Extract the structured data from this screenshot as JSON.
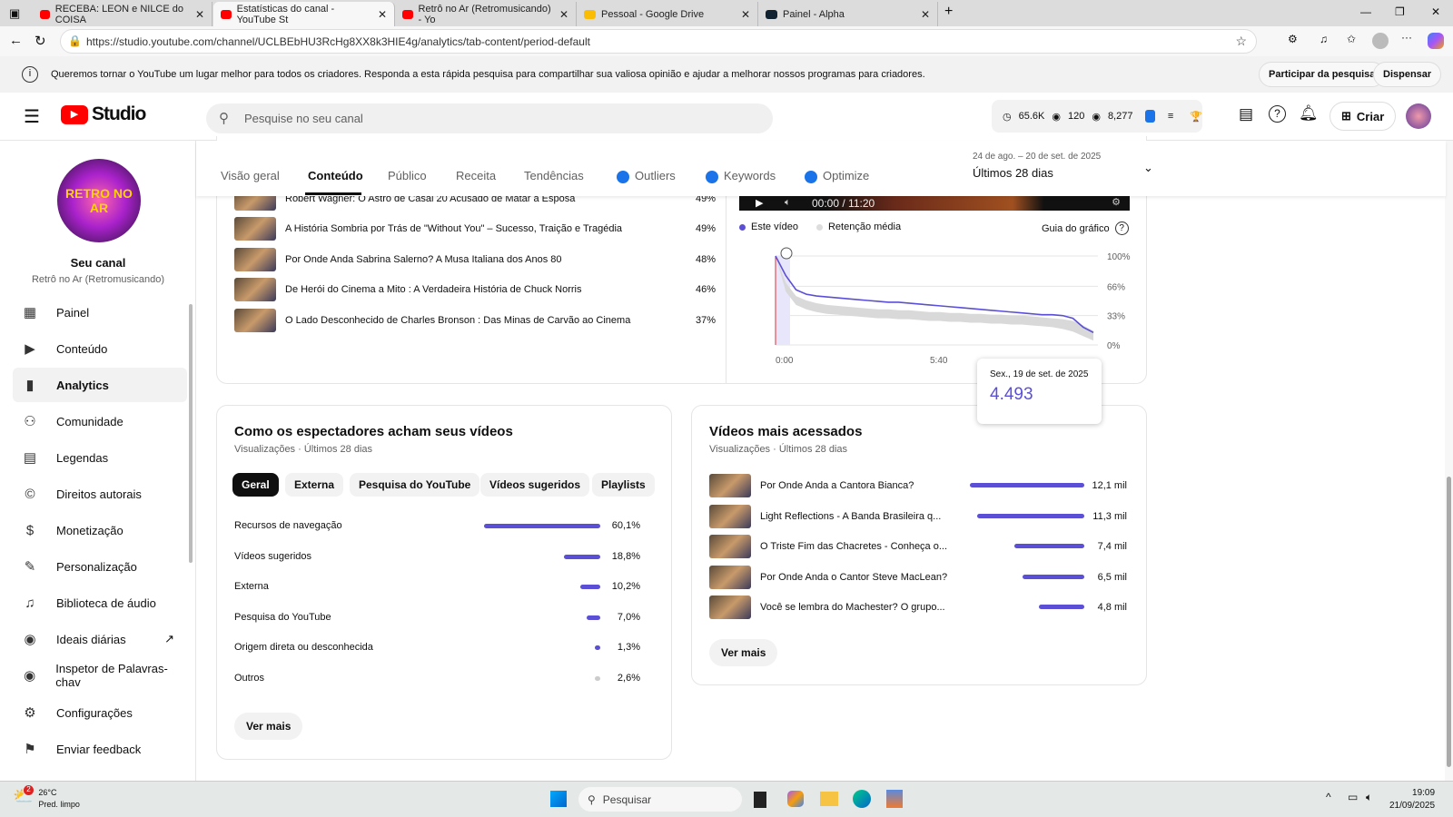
{
  "browser": {
    "tabs": [
      {
        "label": "RECEBA: LEON e NILCE do COISA"
      },
      {
        "label": "Estatísticas do canal - YouTube St"
      },
      {
        "label": "Retrô no Ar (Retromusicando) - Yo"
      },
      {
        "label": "Pessoal - Google Drive"
      },
      {
        "label": "Painel - Alpha"
      }
    ],
    "url": "https://studio.youtube.com/channel/UCLBEbHU3RcHg8XX8k3HIE4g/analytics/tab-content/period-default"
  },
  "notice": {
    "text": "Queremos tornar o YouTube um lugar melhor para todos os criadores. Responda a esta rápida pesquisa para compartilhar sua valiosa opinião e ajudar a melhorar nossos programas para criadores.",
    "participate": "Participar da pesquisa",
    "dismiss": "Dispensar"
  },
  "header": {
    "logo": "Studio",
    "search_placeholder": "Pesquise no seu canal",
    "stats": {
      "watch": "65.6K",
      "views": "120",
      "subs": "8,277"
    },
    "create": "Criar"
  },
  "channel": {
    "title": "Seu canal",
    "name": "Retrô no Ar (Retromusicando)",
    "avatar_text": "RETRO NO AR"
  },
  "sidebar": {
    "items": [
      {
        "label": "Painel",
        "icon": "dashboard-icon"
      },
      {
        "label": "Conteúdo",
        "icon": "content-icon"
      },
      {
        "label": "Analytics",
        "icon": "analytics-icon"
      },
      {
        "label": "Comunidade",
        "icon": "community-icon"
      },
      {
        "label": "Legendas",
        "icon": "subtitles-icon"
      },
      {
        "label": "Direitos autorais",
        "icon": "copyright-icon"
      },
      {
        "label": "Monetização",
        "icon": "dollar-icon"
      },
      {
        "label": "Personalização",
        "icon": "wand-icon"
      },
      {
        "label": "Biblioteca de áudio",
        "icon": "audio-library-icon"
      },
      {
        "label": "Ideais diárias",
        "icon": "vidiq-icon"
      },
      {
        "label": "Inspetor de Palavras-chav",
        "icon": "vidiq-icon"
      },
      {
        "label": "Configurações",
        "icon": "gear-icon"
      },
      {
        "label": "Enviar feedback",
        "icon": "feedback-icon"
      }
    ]
  },
  "tabs": {
    "items": [
      "Visão geral",
      "Conteúdo",
      "Público",
      "Receita",
      "Tendências",
      "Outliers",
      "Keywords",
      "Optimize"
    ],
    "date_range": "24 de ago. – 20 de set. de 2025",
    "period": "Últimos 28 dias"
  },
  "retention_list": [
    {
      "title": "Robert Wagner: O Astro de Casal 20 Acusado de Matar a Esposa",
      "pct": "49%"
    },
    {
      "title": "A História Sombria por Trás de \"Without You\" – Sucesso, Traição e Tragédia",
      "pct": "49%"
    },
    {
      "title": "Por Onde Anda Sabrina Salerno? A Musa Italiana dos Anos 80",
      "pct": "48%"
    },
    {
      "title": "De Herói do Cinema a Mito : A Verdadeira História de Chuck Norris",
      "pct": "46%"
    },
    {
      "title": "O Lado Desconhecido de Charles Bronson : Das Minas de Carvão ao Cinema",
      "pct": "37%"
    }
  ],
  "player": {
    "time": "00:00 / 11:20"
  },
  "retention_chart": {
    "legend": [
      "Este vídeo",
      "Retenção média"
    ],
    "guide": "Guia do gráfico",
    "y_ticks": [
      "100%",
      "66%",
      "33%",
      "0%"
    ],
    "x_ticks": [
      "0:00",
      "5:40"
    ],
    "this_video": [
      100,
      78,
      62,
      57,
      55,
      54,
      53,
      52,
      51,
      50,
      49,
      48,
      48,
      47,
      46,
      45,
      44,
      43,
      42,
      41,
      40,
      39,
      38,
      37,
      36,
      35,
      34,
      34,
      33,
      30,
      20,
      14
    ],
    "avg_high": [
      100,
      70,
      55,
      50,
      47,
      45,
      44,
      43,
      42,
      41,
      40,
      40,
      39,
      39,
      38,
      37,
      37,
      36,
      36,
      35,
      35,
      34,
      34,
      33,
      33,
      32,
      31,
      30,
      29,
      27,
      22,
      16
    ],
    "avg_low": [
      100,
      60,
      45,
      40,
      37,
      35,
      34,
      33,
      32,
      31,
      30,
      30,
      29,
      29,
      28,
      27,
      27,
      26,
      26,
      25,
      25,
      24,
      24,
      23,
      23,
      22,
      21,
      20,
      18,
      15,
      10,
      5
    ],
    "colors": {
      "this": "#5b4fd6",
      "avg": "#d9d9d9"
    }
  },
  "tooltip": {
    "date": "Sex., 19 de set. de 2025",
    "value": "4.493"
  },
  "traffic": {
    "title": "Como os espectadores acham seus vídeos",
    "subtitle": "Visualizações · Últimos 28 dias",
    "chips": [
      "Geral",
      "Externa",
      "Pesquisa do YouTube",
      "Vídeos sugeridos",
      "Playlists"
    ],
    "rows": [
      {
        "label": "Recursos de navegação",
        "value": "60,1%",
        "pct": 60.1
      },
      {
        "label": "Vídeos sugeridos",
        "value": "18,8%",
        "pct": 18.8
      },
      {
        "label": "Externa",
        "value": "10,2%",
        "pct": 10.2
      },
      {
        "label": "Pesquisa do YouTube",
        "value": "7,0%",
        "pct": 7.0
      },
      {
        "label": "Origem direta ou desconhecida",
        "value": "1,3%",
        "pct": 1.3
      },
      {
        "label": "Outros",
        "value": "2,6%",
        "pct": 2.6
      }
    ],
    "more": "Ver mais"
  },
  "top_videos": {
    "title": "Vídeos mais acessados",
    "subtitle": "Visualizações · Últimos 28 dias",
    "rows": [
      {
        "title": "Por Onde Anda a Cantora Bianca?",
        "value": "12,1 mil",
        "n": 12.1
      },
      {
        "title": "Light Reflections - A Banda Brasileira q...",
        "value": "11,3 mil",
        "n": 11.3
      },
      {
        "title": "O Triste Fim das Chacretes - Conheça o...",
        "value": "7,4 mil",
        "n": 7.4
      },
      {
        "title": "Por Onde Anda o Cantor Steve MacLean?",
        "value": "6,5 mil",
        "n": 6.5
      },
      {
        "title": "Você se lembra do Machester? O grupo...",
        "value": "4,8 mil",
        "n": 4.8
      }
    ],
    "more": "Ver mais"
  },
  "taskbar": {
    "temp": "26°C",
    "weather": "Pred. limpo",
    "badge": "2",
    "search": "Pesquisar",
    "time": "19:09",
    "date": "21/09/2025"
  }
}
